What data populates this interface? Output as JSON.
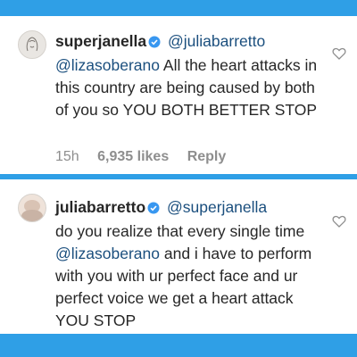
{
  "comments": [
    {
      "username": "superjanella",
      "verified": true,
      "mentions": [
        "@juliabarretto",
        "@lizasoberano"
      ],
      "text": "All the heart attacks in this country are being caused by both of you so YOU BOTH BETTER STOP",
      "time": "15h",
      "likes": "6,935 likes",
      "reply_label": "Reply",
      "icons": {
        "verified": "verified-badge-icon",
        "like": "heart-outline-icon"
      }
    },
    {
      "username": "juliabarretto",
      "verified": true,
      "mention_reply": "@superjanella",
      "text_before": "do you realize that every single time",
      "mention_inline": "@lizasoberano",
      "text_after": "and i have to perform with you with ur perfect face and ur perfect voice we get a heart attack YOU STOP",
      "icons": {
        "verified": "verified-badge-icon",
        "like": "heart-outline-icon"
      }
    }
  ],
  "colors": {
    "background_frame": "#2f9fe6",
    "mention": "#1b4f7e",
    "verified_badge": "#3897f0",
    "meta_text": "#8e8e8e"
  }
}
